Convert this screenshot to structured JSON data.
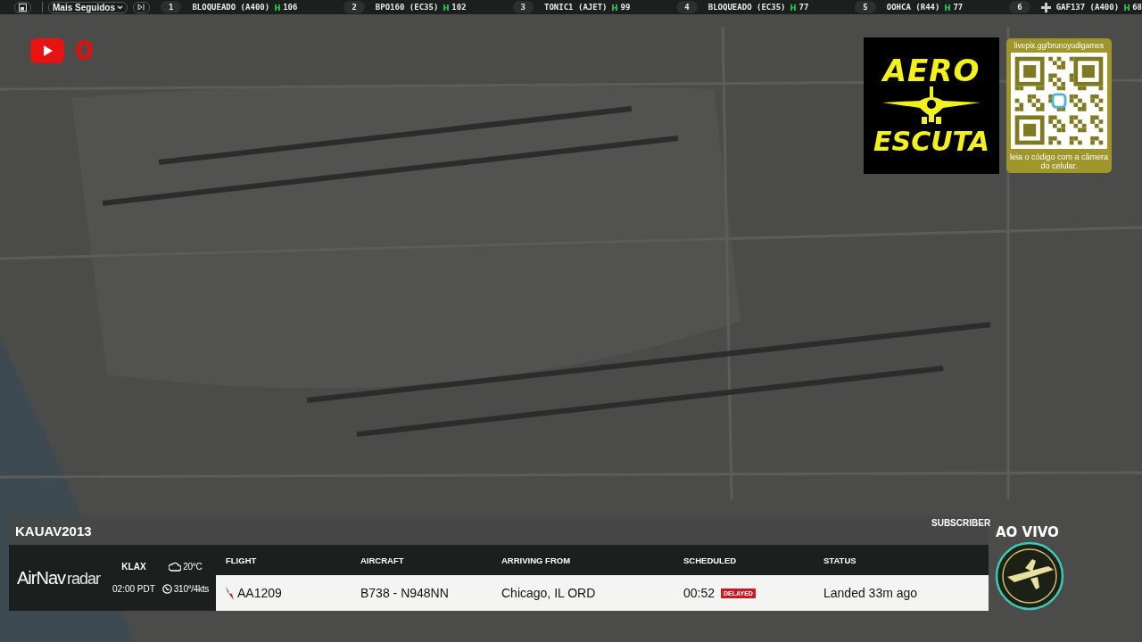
{
  "top_bar": {
    "dropdown": "Mais Seguidos",
    "ranking": [
      {
        "rank": "1",
        "callsign": "BLOQUEADO (A400)",
        "count": "106",
        "kind": "plain"
      },
      {
        "rank": "2",
        "callsign": "BPO160 (EC35)",
        "count": "102",
        "kind": "plain"
      },
      {
        "rank": "3",
        "callsign": "TONIC1 (AJET)",
        "count": "99",
        "kind": "plain"
      },
      {
        "rank": "4",
        "callsign": "BLOQUEADO (EC35)",
        "count": "77",
        "kind": "plain"
      },
      {
        "rank": "5",
        "callsign": "OOHCA (R44)",
        "count": "77",
        "kind": "plain"
      },
      {
        "rank": "6",
        "callsign": "GAF137 (A400)",
        "count": "68",
        "kind": "emblem"
      }
    ]
  },
  "youtube": {
    "count": "0"
  },
  "aero_escuta": {
    "line_1": "AERO",
    "line_2": "ESCUTA"
  },
  "qr_card": {
    "url": "livepix.gg/brunoyudigames",
    "caption": "leia o código com a câmera do celular."
  },
  "overlay": {
    "username": "KAUAV2013",
    "subscriber": "SUBSCRIBER",
    "live": "AO VIVO"
  },
  "flight_panel": {
    "brand_1": "AirNav",
    "brand_2": "radar",
    "airport": "KLAX",
    "time": "02:00 PDT",
    "temperature": "20°C",
    "wind": "310°/4kts",
    "columns": [
      "FLIGHT",
      "AIRCRAFT",
      "ARRIVING FROM",
      "SCHEDULED",
      "STATUS"
    ],
    "row": {
      "flight": "AA1209",
      "aircraft": "B738 - N948NN",
      "origin": "Chicago, IL ORD",
      "scheduled": "00:52",
      "badge": "DELAYED",
      "status": "Landed 33m ago"
    }
  }
}
